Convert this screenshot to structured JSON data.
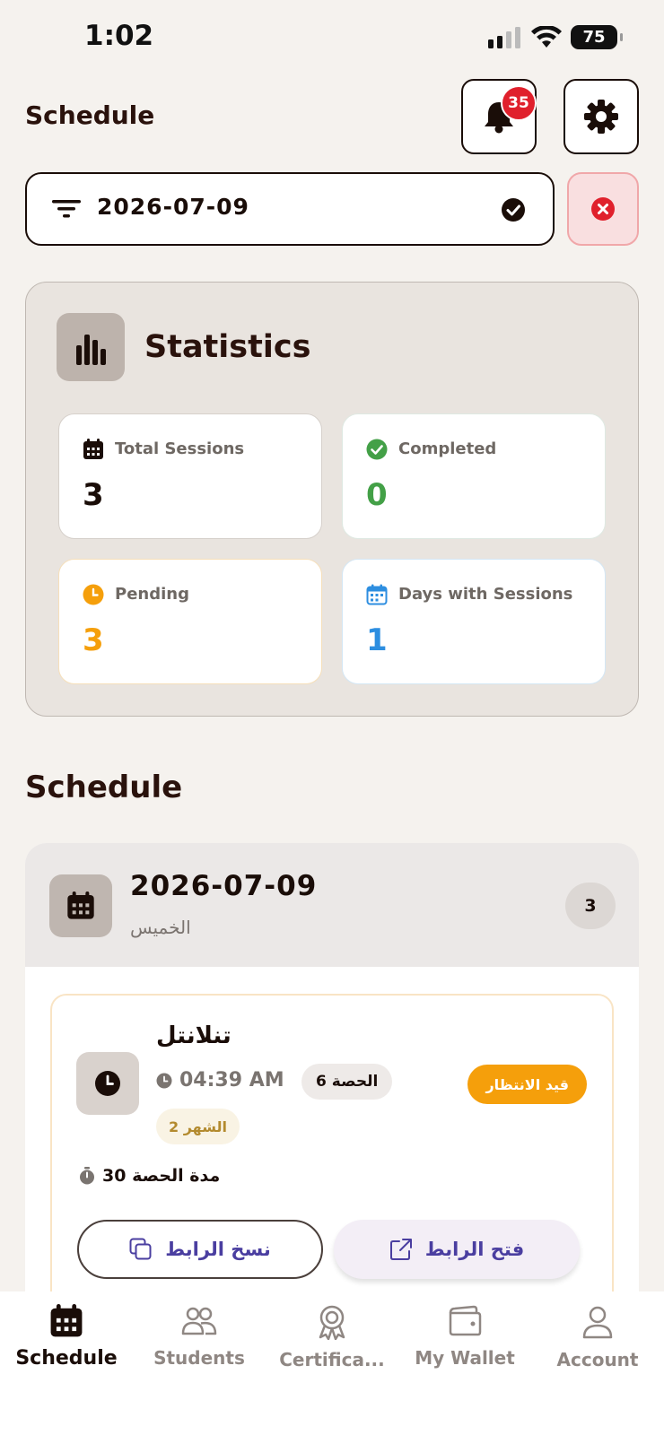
{
  "status_bar": {
    "time": "1:02",
    "battery": "75"
  },
  "header": {
    "title": "Schedule",
    "notification_count": "35"
  },
  "filter": {
    "value": "2026-07-09"
  },
  "statistics": {
    "title": "Statistics",
    "tiles": [
      {
        "label": "Total Sessions",
        "value": "3",
        "color": "#1a0d08"
      },
      {
        "label": "Completed",
        "value": "0",
        "color": "#43a047"
      },
      {
        "label": "Pending",
        "value": "3",
        "color": "#f59f0b"
      },
      {
        "label": "Days with Sessions",
        "value": "1",
        "color": "#2d8ee0"
      }
    ]
  },
  "schedule": {
    "title": "Schedule",
    "day": {
      "date": "2026-07-09",
      "weekday": "الخميس",
      "count": "3",
      "session": {
        "student_name": "تنلانتل",
        "time": "04:39 AM",
        "lesson": "الحصة 6",
        "month": "الشهر 2",
        "status": "قيد الانتظار",
        "duration": "30 مدة الحصة",
        "copy_link": "نسخ الرابط",
        "open_link": "فتح الرابط"
      }
    }
  },
  "tabbar": {
    "items": [
      {
        "label": "Schedule",
        "icon": "calendar-icon",
        "active": true
      },
      {
        "label": "Students",
        "icon": "people-icon"
      },
      {
        "label": "Certifica...",
        "icon": "award-icon"
      },
      {
        "label": "My Wallet",
        "icon": "wallet-icon"
      },
      {
        "label": "Account",
        "icon": "person-icon"
      }
    ]
  },
  "colors": {
    "accent_warning": "#f59f0b",
    "danger": "#e0202c",
    "background": "#f5f2ee"
  }
}
